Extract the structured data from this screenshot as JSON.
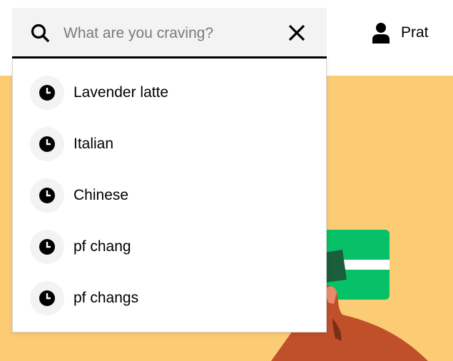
{
  "search": {
    "placeholder": "What are you craving?",
    "value": ""
  },
  "header": {
    "user_name": "Prat"
  },
  "suggestions": [
    {
      "label": "Lavender latte"
    },
    {
      "label": "Italian"
    },
    {
      "label": "Chinese"
    },
    {
      "label": "pf chang"
    },
    {
      "label": "pf changs"
    }
  ],
  "icons": {
    "search": "search-icon",
    "clear": "close-icon",
    "user": "user-icon",
    "history": "clock-icon"
  },
  "colors": {
    "hero_background": "#fccc74",
    "card_green": "#06c167",
    "hand_brown": "#c0502a",
    "search_background": "#f3f3f3",
    "text": "#000000",
    "placeholder": "#7a7a7a"
  }
}
